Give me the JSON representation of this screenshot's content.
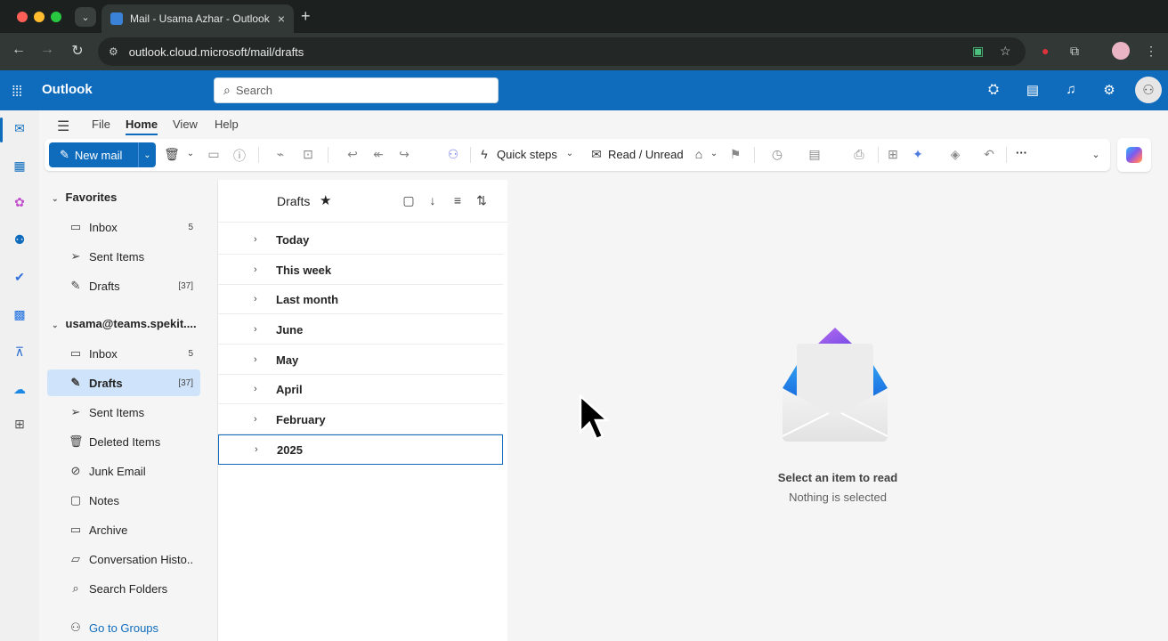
{
  "browser": {
    "tab_title": "Mail - Usama Azhar - Outlook",
    "url": "outlook.cloud.microsoft/mail/drafts"
  },
  "header": {
    "brand": "Outlook",
    "search_placeholder": "Search"
  },
  "menu": {
    "file": "File",
    "home": "Home",
    "view": "View",
    "help": "Help"
  },
  "ribbon": {
    "new_mail": "New mail",
    "quick_steps": "Quick steps",
    "read_unread": "Read / Unread",
    "more": "···"
  },
  "folders": {
    "favorites_label": "Favorites",
    "favorites": [
      {
        "name": "Inbox",
        "count": "5"
      },
      {
        "name": "Sent Items",
        "count": ""
      },
      {
        "name": "Drafts",
        "count": "[37]"
      }
    ],
    "account_label": "usama@teams.spekit....",
    "account": [
      {
        "name": "Inbox",
        "count": "5"
      },
      {
        "name": "Drafts",
        "count": "[37]"
      },
      {
        "name": "Sent Items",
        "count": ""
      },
      {
        "name": "Deleted Items",
        "count": ""
      },
      {
        "name": "Junk Email",
        "count": ""
      },
      {
        "name": "Notes",
        "count": ""
      },
      {
        "name": "Archive",
        "count": ""
      },
      {
        "name": "Conversation Histo...",
        "count": ""
      },
      {
        "name": "Search Folders",
        "count": ""
      }
    ],
    "go_to_groups": "Go to Groups"
  },
  "list": {
    "title": "Drafts",
    "groups": [
      "Today",
      "This week",
      "Last month",
      "June",
      "May",
      "April",
      "February",
      "2025"
    ]
  },
  "reading": {
    "empty_title": "Select an item to read",
    "empty_sub": "Nothing is selected"
  },
  "colors": {
    "brand_blue": "#0f6cbd",
    "selected_bg": "#cfe4fa"
  }
}
